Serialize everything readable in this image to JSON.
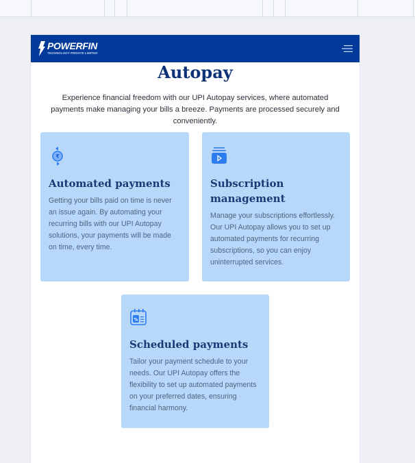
{
  "brand": {
    "name": "POWERFIN",
    "tagline": "TECHNOLOGY PRIVATE LIMITED"
  },
  "page": {
    "title": "Autopay",
    "intro": "Experience financial freedom with our UPI Autopay services, where automated payments make managing your bills a breeze. Payments are processed securely and conveniently."
  },
  "cards": [
    {
      "icon": "rupee-exchange-icon",
      "title": "Automated payments",
      "text": "Getting your bills paid on time is never an issue again. By automating your recurring bills with our UPI Autopay solutions, your payments will be made on time, every time."
    },
    {
      "icon": "subscription-play-icon",
      "title": "Subscription management",
      "text": "Manage your subscriptions effortlessly. Our UPI Autopay allows you to set up automated payments for recurring subscriptions, so you can enjoy uninterrupted services."
    },
    {
      "icon": "calendar-percent-icon",
      "title": "Scheduled payments",
      "text": "Tailor your payment schedule to your needs. Our UPI Autopay offers the flexibility to set up automated payments on your preferred dates, ensuring financial harmony."
    }
  ],
  "colors": {
    "navbar": "#023a9a",
    "card": "#b8d8f9",
    "heading": "#0b3277",
    "icon": "#2d7cf0"
  }
}
